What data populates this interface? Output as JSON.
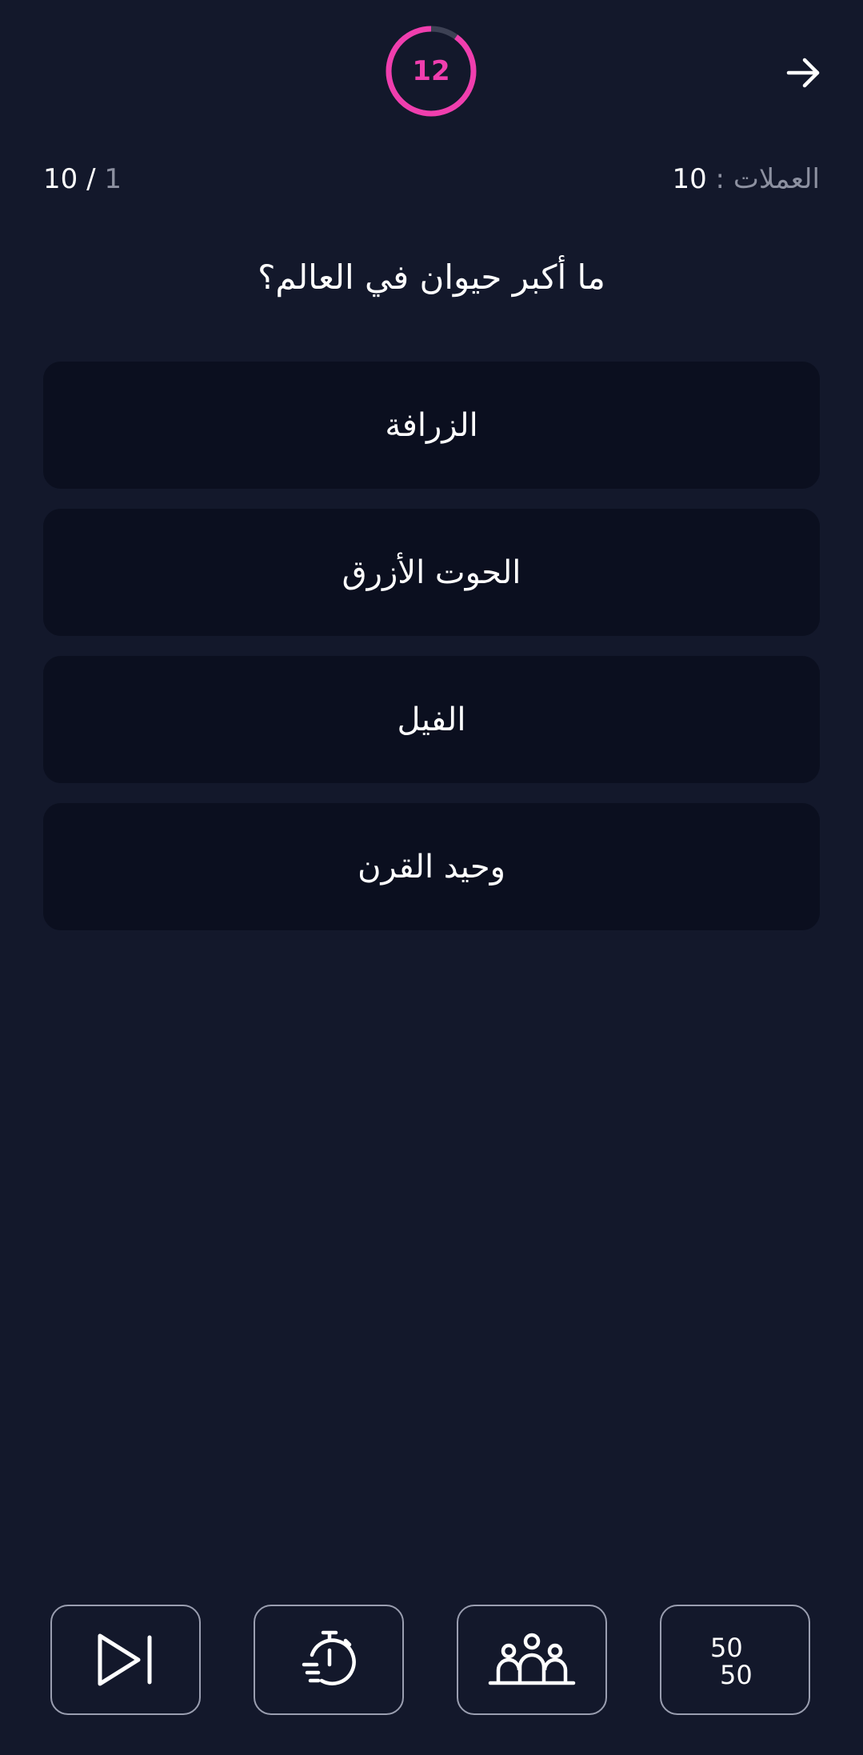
{
  "header": {
    "timer": {
      "value": "12",
      "fraction_remaining": 0.9
    },
    "back_icon": "arrow-right-icon"
  },
  "status": {
    "coins_label": "العملات",
    "coins_separator": ":",
    "coins_value": "10",
    "progress_current": "1",
    "progress_separator": "/",
    "progress_total": "10"
  },
  "question": {
    "text": "ما أكبر حيوان في العالم؟"
  },
  "answers": [
    {
      "label": "الزرافة"
    },
    {
      "label": "الحوت الأزرق"
    },
    {
      "label": "الفيل"
    },
    {
      "label": "وحيد القرن"
    }
  ],
  "lifelines": [
    {
      "icon": "skip-icon"
    },
    {
      "icon": "stopwatch-icon"
    },
    {
      "icon": "audience-icon"
    },
    {
      "icon": "fifty-fifty-icon",
      "text_top": "50",
      "text_bottom": "50"
    }
  ],
  "colors": {
    "background": "#13182b",
    "card": "#0b0f1f",
    "accent": "#f03eae",
    "muted": "#8c90a0"
  }
}
